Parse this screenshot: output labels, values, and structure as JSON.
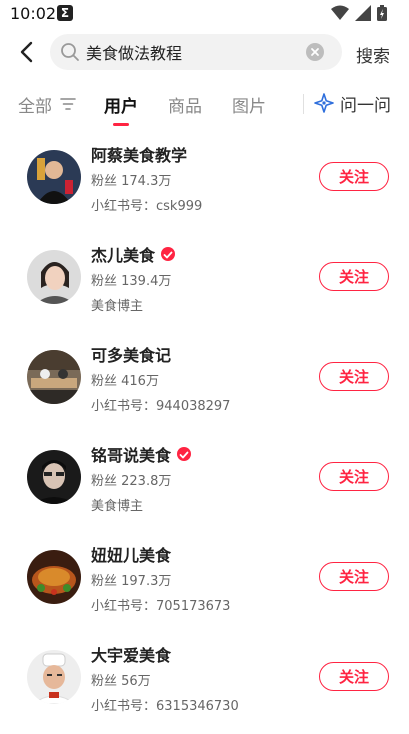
{
  "status_bar": {
    "time": "10:02",
    "app_icon_letter": "Σ"
  },
  "search": {
    "query": "美食做法教程",
    "button_label": "搜索"
  },
  "tabs": [
    {
      "label": "全部",
      "active": false
    },
    {
      "label": "用户",
      "active": true
    },
    {
      "label": "商品",
      "active": false
    },
    {
      "label": "图片",
      "active": false
    }
  ],
  "ask": {
    "label": "问一问"
  },
  "accent_color": "#ff2442",
  "users": [
    {
      "name": "阿蔡美食教学",
      "verified": false,
      "fans": "粉丝 174.3万",
      "meta": "小红书号：csk999",
      "follow": "关注"
    },
    {
      "name": "杰儿美食",
      "verified": true,
      "fans": "粉丝 139.4万",
      "meta": "美食博主",
      "follow": "关注"
    },
    {
      "name": "可多美食记",
      "verified": false,
      "fans": "粉丝 416万",
      "meta": "小红书号：944038297",
      "follow": "关注"
    },
    {
      "name": "铭哥说美食",
      "verified": true,
      "fans": "粉丝 223.8万",
      "meta": "美食博主",
      "follow": "关注"
    },
    {
      "name": "妞妞儿美食",
      "verified": false,
      "fans": "粉丝 197.3万",
      "meta": "小红书号：705173673",
      "follow": "关注"
    },
    {
      "name": "大宇爱美食",
      "verified": false,
      "fans": "粉丝 56万",
      "meta": "小红书号：6315346730",
      "follow": "关注"
    }
  ]
}
